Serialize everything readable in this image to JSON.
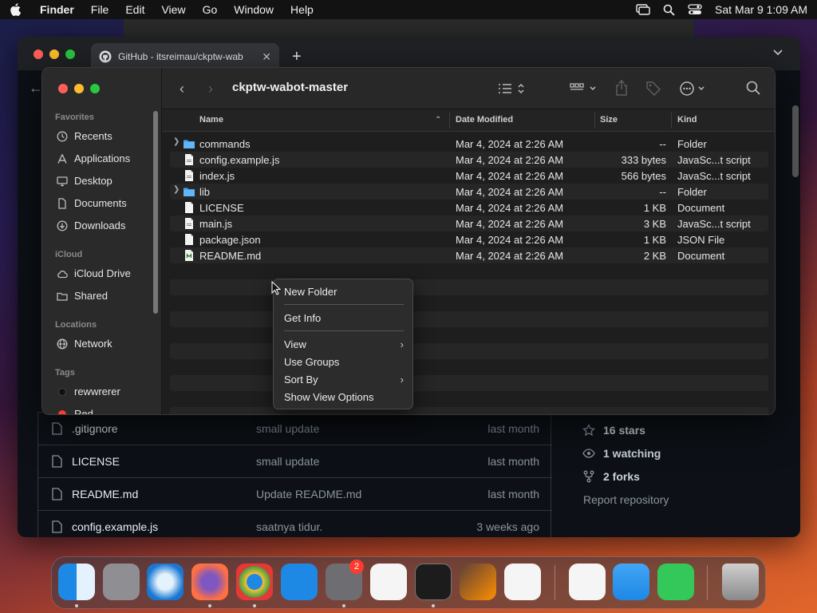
{
  "menubar": {
    "app_name": "Finder",
    "menus": [
      "File",
      "Edit",
      "View",
      "Go",
      "Window",
      "Help"
    ],
    "clock": "Sat Mar 9  1:09 AM"
  },
  "browser": {
    "tab_title": "GitHub - itsreimau/ckptw-wab",
    "github_files": [
      {
        "name": ".gitignore",
        "commit": "small update",
        "when": "last month"
      },
      {
        "name": "LICENSE",
        "commit": "small update",
        "when": "last month"
      },
      {
        "name": "README.md",
        "commit": "Update README.md",
        "when": "last month"
      },
      {
        "name": "config.example.js",
        "commit": "saatnya tidur.",
        "when": "3 weeks ago"
      }
    ],
    "sidebar_stats": {
      "stars": "16 stars",
      "watching": "1 watching",
      "forks": "2 forks",
      "report": "Report repository"
    }
  },
  "finder": {
    "title": "ckptw-wabot-master",
    "sidebar": {
      "favorites_label": "Favorites",
      "favorites": [
        "Recents",
        "Applications",
        "Desktop",
        "Documents",
        "Downloads"
      ],
      "icloud_label": "iCloud",
      "icloud": [
        "iCloud Drive",
        "Shared"
      ],
      "locations_label": "Locations",
      "locations": [
        "Network"
      ],
      "tags_label": "Tags",
      "tags": [
        {
          "name": "rewwrerer",
          "color": "#111111"
        },
        {
          "name": "Red",
          "color": "#ff3b30"
        }
      ]
    },
    "columns": {
      "name": "Name",
      "date": "Date Modified",
      "size": "Size",
      "kind": "Kind"
    },
    "files": [
      {
        "name": "commands",
        "type": "folder",
        "date": "Mar 4, 2024 at 2:26 AM",
        "size": "--",
        "kind": "Folder"
      },
      {
        "name": "config.example.js",
        "type": "file",
        "date": "Mar 4, 2024 at 2:26 AM",
        "size": "333 bytes",
        "kind": "JavaSc...t script"
      },
      {
        "name": "index.js",
        "type": "file",
        "date": "Mar 4, 2024 at 2:26 AM",
        "size": "566 bytes",
        "kind": "JavaSc...t script"
      },
      {
        "name": "lib",
        "type": "folder",
        "date": "Mar 4, 2024 at 2:26 AM",
        "size": "--",
        "kind": "Folder"
      },
      {
        "name": "LICENSE",
        "type": "file",
        "date": "Mar 4, 2024 at 2:26 AM",
        "size": "1 KB",
        "kind": "Document"
      },
      {
        "name": "main.js",
        "type": "file",
        "date": "Mar 4, 2024 at 2:26 AM",
        "size": "3 KB",
        "kind": "JavaSc...t script"
      },
      {
        "name": "package.json",
        "type": "file",
        "date": "Mar 4, 2024 at 2:26 AM",
        "size": "1 KB",
        "kind": "JSON File"
      },
      {
        "name": "README.md",
        "type": "md",
        "date": "Mar 4, 2024 at 2:26 AM",
        "size": "2 KB",
        "kind": "Document"
      }
    ]
  },
  "context_menu": {
    "new_folder": "New Folder",
    "get_info": "Get Info",
    "view": "View",
    "use_groups": "Use Groups",
    "sort_by": "Sort By",
    "show_view_options": "Show View Options"
  },
  "dock": {
    "settings_badge": "2",
    "apps": [
      "finder-icon",
      "launchpad-icon",
      "safari-icon",
      "firefox-icon",
      "chrome-icon",
      "app-store-icon",
      "system-settings-icon",
      "textedit-icon",
      "terminal-icon",
      "garageband-icon",
      "vscode-icon",
      "visual-studio-icon",
      "weather-icon",
      "facetime-icon",
      "trash-icon"
    ]
  }
}
